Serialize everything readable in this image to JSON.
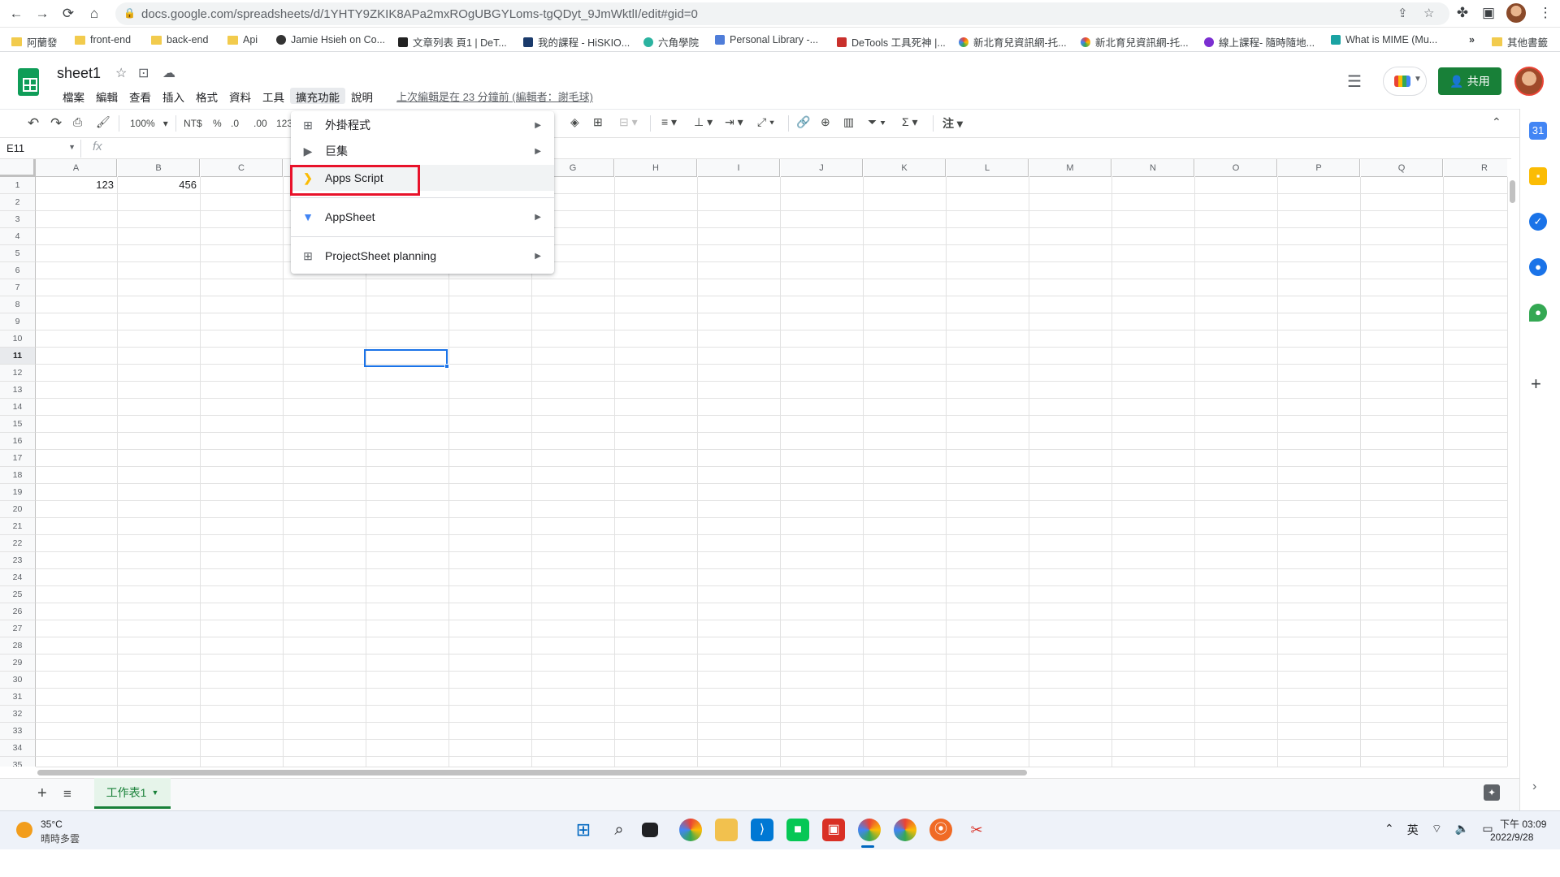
{
  "browser": {
    "url": "docs.google.com/spreadsheets/d/1YHTY9ZKIK8APa2mxROgUBGYLoms-tgQDyt_9JmWktlI/edit#gid=0",
    "bookmarks": [
      "阿蘭發",
      "front-end",
      "back-end",
      "Api",
      "Jamie Hsieh on Co...",
      "文章列表 頁1 | DeT...",
      "我的課程 - HiSKIO...",
      "六角學院",
      "Personal Library -...",
      "DeTools 工具死神 |...",
      "新北育兒資訊網-托...",
      "新北育兒資訊網-托...",
      "線上課程- 隨時隨地...",
      "What is MIME (Mu...",
      "»",
      "其他書籤"
    ]
  },
  "sheets": {
    "doc_title": "sheet1",
    "menu": [
      "檔案",
      "編輯",
      "查看",
      "插入",
      "格式",
      "資料",
      "工具",
      "擴充功能",
      "說明"
    ],
    "last_edit": "上次編輯是在 23 分鐘前 (編輯者：謝毛球)",
    "share_label": "共用"
  },
  "toolbar": {
    "zoom": "100%",
    "currency": "NT$",
    "percent": "%",
    "dec_less": ".0",
    "dec_more": ".00",
    "format_more": "123"
  },
  "formula": {
    "name_box": "E11",
    "fx": "fx"
  },
  "grid": {
    "columns": [
      "A",
      "B",
      "C",
      "D",
      "E",
      "F",
      "G",
      "H",
      "I",
      "J",
      "K",
      "L",
      "M",
      "N",
      "O",
      "P",
      "Q",
      "R"
    ],
    "rows": [
      "1",
      "2",
      "3",
      "4",
      "5",
      "6",
      "7",
      "8",
      "9",
      "10",
      "11",
      "12",
      "13",
      "14",
      "15",
      "16",
      "17",
      "18",
      "19",
      "20",
      "21",
      "22",
      "23",
      "24",
      "25",
      "26",
      "27",
      "28",
      "29",
      "30",
      "31",
      "32",
      "33",
      "34",
      "35"
    ],
    "cells": {
      "A1": "123",
      "B1": "456"
    },
    "selected": "E11"
  },
  "extensions_menu": {
    "items": [
      {
        "label": "外掛程式",
        "icon": "addon-icon",
        "submenu": true
      },
      {
        "label": "巨集",
        "icon": "macro-icon",
        "submenu": true
      },
      {
        "label": "Apps Script",
        "icon": "apps-script-icon",
        "submenu": false
      },
      {
        "label": "AppSheet",
        "icon": "appsheet-icon",
        "submenu": true
      },
      {
        "label": "ProjectSheet planning",
        "icon": "projectsheet-icon",
        "submenu": true
      }
    ]
  },
  "tabs": {
    "sheet_name": "工作表1"
  },
  "taskbar": {
    "weather_temp": "35°C",
    "weather_desc": "晴時多雲",
    "ime": "英",
    "time": "下午 03:09",
    "date": "2022/9/28"
  },
  "colors": {
    "accent_green": "#188038",
    "selection_blue": "#1a73e8",
    "highlight_red": "#e8122a"
  }
}
